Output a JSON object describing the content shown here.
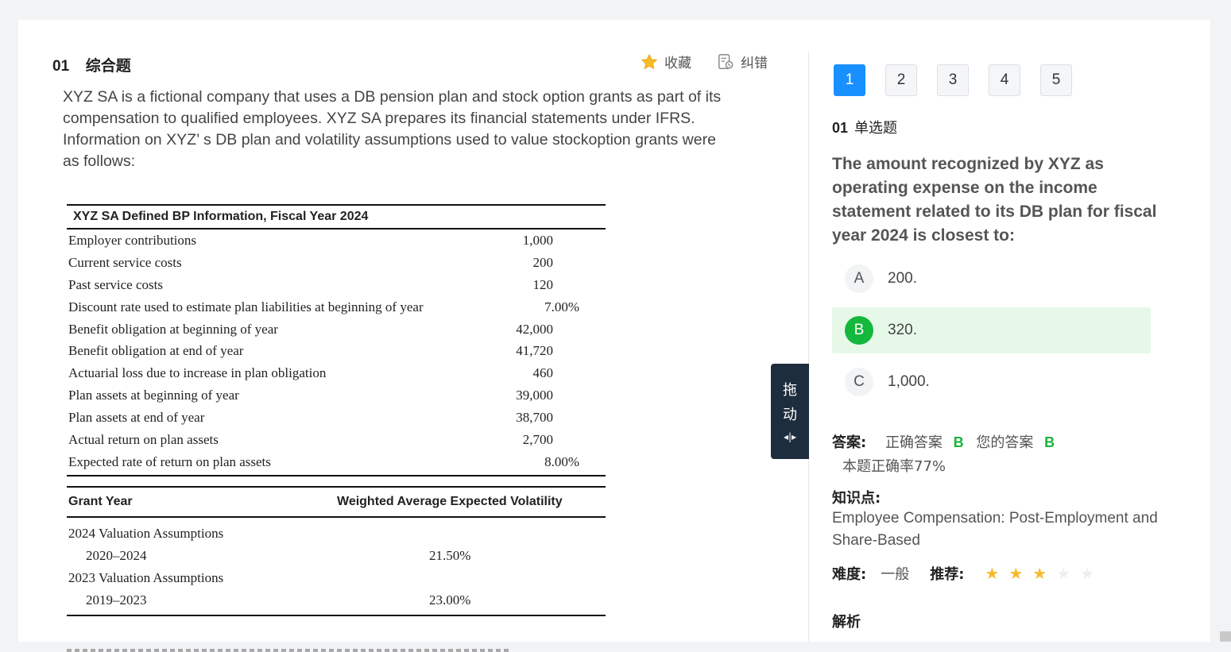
{
  "question": {
    "number": "01",
    "type": "综合题",
    "favorite_label": "收藏",
    "report_label": "纠错",
    "stem": [
      "XYZ SA is a fictional company that uses a DB pension plan and stock option grants as part of its",
      "compensation to qualified employees. XYZ SA prepares its financial statements under IFRS.",
      "Information on XYZ’ s DB plan and volatility assumptions used to value stockoption grants were",
      "as follows:"
    ]
  },
  "table1": {
    "title": "XYZ SA Defined BP Information, Fiscal Year 2024",
    "rows": [
      {
        "label": "Employer contributions",
        "value": "1,000"
      },
      {
        "label": "Current service costs",
        "value": "200"
      },
      {
        "label": "Past service costs",
        "value": "120"
      },
      {
        "label": "Discount rate used to estimate plan liabilities at beginning of year",
        "value": "7.00%"
      },
      {
        "label": "Benefit obligation at beginning of year",
        "value": "42,000"
      },
      {
        "label": "Benefit obligation at end of year",
        "value": "41,720"
      },
      {
        "label": "Actuarial loss due to increase in plan obligation",
        "value": "460"
      },
      {
        "label": "Plan assets at beginning of year",
        "value": "39,000"
      },
      {
        "label": "Plan assets at end of year",
        "value": "38,700"
      },
      {
        "label": "Actual return on plan assets",
        "value": "2,700"
      },
      {
        "label": "Expected rate of return on plan assets",
        "value": "8.00%"
      }
    ]
  },
  "table2": {
    "col1": "Grant Year",
    "col2": "Weighted Average Expected Volatility",
    "rows": [
      {
        "label": "2024 Valuation Assumptions",
        "value": ""
      },
      {
        "label": "2020–2024",
        "value": "21.50%"
      },
      {
        "label": "2023 Valuation Assumptions",
        "value": ""
      },
      {
        "label": "2019–2023",
        "value": "23.00%"
      }
    ]
  },
  "drag_handle": {
    "line1": "拖",
    "line2": "动",
    "icon": "◂|▸"
  },
  "nav": {
    "items": [
      "1",
      "2",
      "3",
      "4",
      "5"
    ],
    "active": "1"
  },
  "sub": {
    "number": "01",
    "type": "单选题",
    "text": "The amount recognized by XYZ as operating expense on the income statement related to its DB plan for fiscal year 2024 is closest to:",
    "options": [
      {
        "letter": "A",
        "text": "200."
      },
      {
        "letter": "B",
        "text": "320."
      },
      {
        "letter": "C",
        "text": "1,000."
      }
    ],
    "selected": "B",
    "answer_label": "答案:",
    "correct_label": "正确答案",
    "correct": "B",
    "mine_label": "您的答案",
    "mine": "B",
    "rate": "本题正确率77%",
    "kp_label": "知识点:",
    "kp": "Employee Compensation: Post-Employment and Share-Based",
    "difficulty_label": "难度:",
    "difficulty": "一般",
    "recommend_label": "推荐:",
    "stars": 3,
    "stars_max": 5,
    "analysis_label": "解析"
  },
  "colors": {
    "accent": "#1890ff",
    "correct": "#14b83c",
    "selected_bg": "#e6f9e9",
    "star": "#f7ba2a",
    "handle": "#1e2d3d"
  }
}
